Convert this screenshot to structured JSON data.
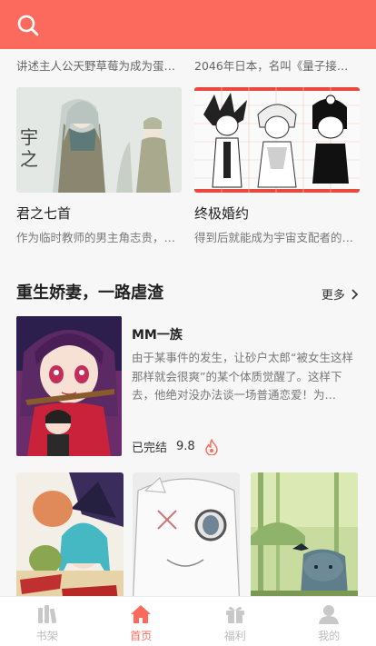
{
  "header": {
    "search_icon": "search-icon",
    "color": "#fb6a5c"
  },
  "top_snippets": [
    "讲述主人公天野草莓为成为蛋…",
    "2046年日本，名叫《量子接续…"
  ],
  "cards": [
    {
      "title": "君之七首",
      "desc": "作为临时教师的男主角志贵，…"
    },
    {
      "title": "终极婚约",
      "desc": "得到后就能成为宇宙支配者的…"
    }
  ],
  "section": {
    "title": "重生娇妻，一路虐渣",
    "more_label": "更多",
    "more_icon": "chevron-right-icon"
  },
  "featured": {
    "title": "MM一族",
    "desc": "由于某事件的发生，让砂户太郎“被女生这样那样就会很爽”的某个体质觉醒了。这样下去，他绝对没办法谈一场普通恋爱！为…",
    "status": "已完结",
    "rating": "9.8",
    "rating_icon": "flame-icon"
  },
  "grid_covers": [
    {
      "name": "cover-witch-manga"
    },
    {
      "name": "cover-white-creature"
    },
    {
      "name": "cover-forest-bear"
    }
  ],
  "tabbar": [
    {
      "label": "书架",
      "icon": "bookshelf-icon",
      "active": false
    },
    {
      "label": "首页",
      "icon": "home-icon",
      "active": true
    },
    {
      "label": "福利",
      "icon": "gift-icon",
      "active": false
    },
    {
      "label": "我的",
      "icon": "user-icon",
      "active": false
    }
  ],
  "colors": {
    "accent": "#fb6a5c",
    "inactive": "#bbbbbb"
  }
}
